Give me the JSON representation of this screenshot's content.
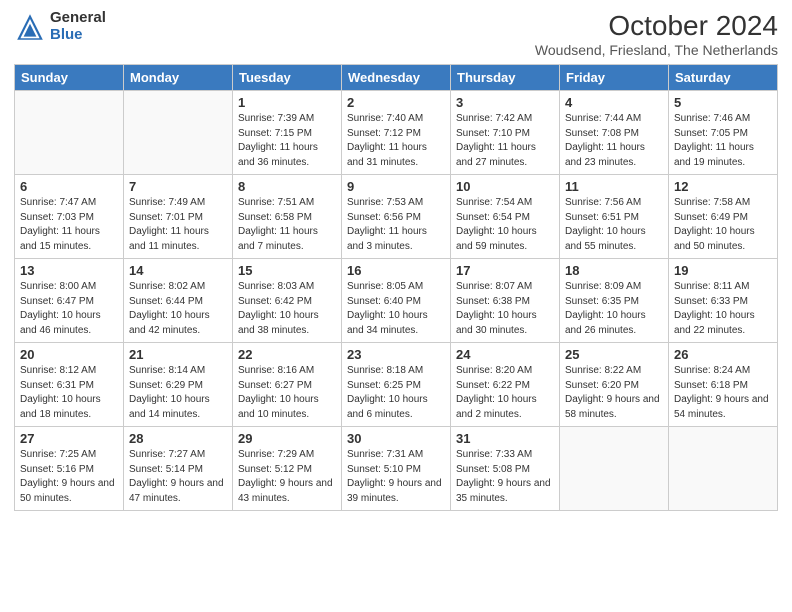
{
  "header": {
    "logo_general": "General",
    "logo_blue": "Blue",
    "month_title": "October 2024",
    "location": "Woudsend, Friesland, The Netherlands"
  },
  "days_of_week": [
    "Sunday",
    "Monday",
    "Tuesday",
    "Wednesday",
    "Thursday",
    "Friday",
    "Saturday"
  ],
  "weeks": [
    [
      {
        "day": "",
        "info": ""
      },
      {
        "day": "",
        "info": ""
      },
      {
        "day": "1",
        "info": "Sunrise: 7:39 AM\nSunset: 7:15 PM\nDaylight: 11 hours and 36 minutes."
      },
      {
        "day": "2",
        "info": "Sunrise: 7:40 AM\nSunset: 7:12 PM\nDaylight: 11 hours and 31 minutes."
      },
      {
        "day": "3",
        "info": "Sunrise: 7:42 AM\nSunset: 7:10 PM\nDaylight: 11 hours and 27 minutes."
      },
      {
        "day": "4",
        "info": "Sunrise: 7:44 AM\nSunset: 7:08 PM\nDaylight: 11 hours and 23 minutes."
      },
      {
        "day": "5",
        "info": "Sunrise: 7:46 AM\nSunset: 7:05 PM\nDaylight: 11 hours and 19 minutes."
      }
    ],
    [
      {
        "day": "6",
        "info": "Sunrise: 7:47 AM\nSunset: 7:03 PM\nDaylight: 11 hours and 15 minutes."
      },
      {
        "day": "7",
        "info": "Sunrise: 7:49 AM\nSunset: 7:01 PM\nDaylight: 11 hours and 11 minutes."
      },
      {
        "day": "8",
        "info": "Sunrise: 7:51 AM\nSunset: 6:58 PM\nDaylight: 11 hours and 7 minutes."
      },
      {
        "day": "9",
        "info": "Sunrise: 7:53 AM\nSunset: 6:56 PM\nDaylight: 11 hours and 3 minutes."
      },
      {
        "day": "10",
        "info": "Sunrise: 7:54 AM\nSunset: 6:54 PM\nDaylight: 10 hours and 59 minutes."
      },
      {
        "day": "11",
        "info": "Sunrise: 7:56 AM\nSunset: 6:51 PM\nDaylight: 10 hours and 55 minutes."
      },
      {
        "day": "12",
        "info": "Sunrise: 7:58 AM\nSunset: 6:49 PM\nDaylight: 10 hours and 50 minutes."
      }
    ],
    [
      {
        "day": "13",
        "info": "Sunrise: 8:00 AM\nSunset: 6:47 PM\nDaylight: 10 hours and 46 minutes."
      },
      {
        "day": "14",
        "info": "Sunrise: 8:02 AM\nSunset: 6:44 PM\nDaylight: 10 hours and 42 minutes."
      },
      {
        "day": "15",
        "info": "Sunrise: 8:03 AM\nSunset: 6:42 PM\nDaylight: 10 hours and 38 minutes."
      },
      {
        "day": "16",
        "info": "Sunrise: 8:05 AM\nSunset: 6:40 PM\nDaylight: 10 hours and 34 minutes."
      },
      {
        "day": "17",
        "info": "Sunrise: 8:07 AM\nSunset: 6:38 PM\nDaylight: 10 hours and 30 minutes."
      },
      {
        "day": "18",
        "info": "Sunrise: 8:09 AM\nSunset: 6:35 PM\nDaylight: 10 hours and 26 minutes."
      },
      {
        "day": "19",
        "info": "Sunrise: 8:11 AM\nSunset: 6:33 PM\nDaylight: 10 hours and 22 minutes."
      }
    ],
    [
      {
        "day": "20",
        "info": "Sunrise: 8:12 AM\nSunset: 6:31 PM\nDaylight: 10 hours and 18 minutes."
      },
      {
        "day": "21",
        "info": "Sunrise: 8:14 AM\nSunset: 6:29 PM\nDaylight: 10 hours and 14 minutes."
      },
      {
        "day": "22",
        "info": "Sunrise: 8:16 AM\nSunset: 6:27 PM\nDaylight: 10 hours and 10 minutes."
      },
      {
        "day": "23",
        "info": "Sunrise: 8:18 AM\nSunset: 6:25 PM\nDaylight: 10 hours and 6 minutes."
      },
      {
        "day": "24",
        "info": "Sunrise: 8:20 AM\nSunset: 6:22 PM\nDaylight: 10 hours and 2 minutes."
      },
      {
        "day": "25",
        "info": "Sunrise: 8:22 AM\nSunset: 6:20 PM\nDaylight: 9 hours and 58 minutes."
      },
      {
        "day": "26",
        "info": "Sunrise: 8:24 AM\nSunset: 6:18 PM\nDaylight: 9 hours and 54 minutes."
      }
    ],
    [
      {
        "day": "27",
        "info": "Sunrise: 7:25 AM\nSunset: 5:16 PM\nDaylight: 9 hours and 50 minutes."
      },
      {
        "day": "28",
        "info": "Sunrise: 7:27 AM\nSunset: 5:14 PM\nDaylight: 9 hours and 47 minutes."
      },
      {
        "day": "29",
        "info": "Sunrise: 7:29 AM\nSunset: 5:12 PM\nDaylight: 9 hours and 43 minutes."
      },
      {
        "day": "30",
        "info": "Sunrise: 7:31 AM\nSunset: 5:10 PM\nDaylight: 9 hours and 39 minutes."
      },
      {
        "day": "31",
        "info": "Sunrise: 7:33 AM\nSunset: 5:08 PM\nDaylight: 9 hours and 35 minutes."
      },
      {
        "day": "",
        "info": ""
      },
      {
        "day": "",
        "info": ""
      }
    ]
  ]
}
